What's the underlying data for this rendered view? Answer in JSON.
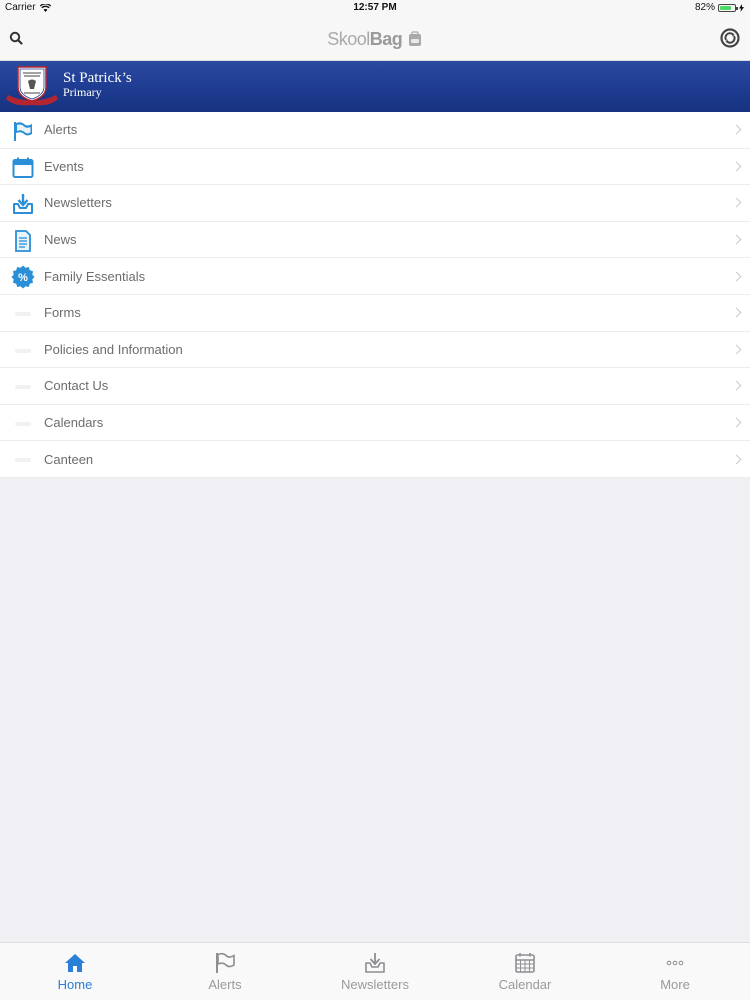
{
  "status_bar": {
    "carrier": "Carrier",
    "time": "12:57 PM",
    "battery": "82%",
    "battery_level": 0.82
  },
  "nav": {
    "logo_light": "Skool",
    "logo_bold": "Bag"
  },
  "banner": {
    "line1": "St Patrick’s",
    "line2": "Primary"
  },
  "menu": [
    {
      "label": "Alerts",
      "icon": "flag-icon"
    },
    {
      "label": "Events",
      "icon": "calendar-icon"
    },
    {
      "label": "Newsletters",
      "icon": "inbox-download-icon"
    },
    {
      "label": "News",
      "icon": "document-icon"
    },
    {
      "label": "Family Essentials",
      "icon": "percent-badge-icon"
    },
    {
      "label": "Forms",
      "icon": "placeholder-icon"
    },
    {
      "label": "Policies and Information",
      "icon": "placeholder-icon"
    },
    {
      "label": "Contact Us",
      "icon": "placeholder-icon"
    },
    {
      "label": "Calendars",
      "icon": "placeholder-icon"
    },
    {
      "label": "Canteen",
      "icon": "placeholder-icon"
    }
  ],
  "tabs": [
    {
      "label": "Home",
      "icon": "home-icon",
      "active": true
    },
    {
      "label": "Alerts",
      "icon": "flag-icon",
      "active": false
    },
    {
      "label": "Newsletters",
      "icon": "inbox-download-icon",
      "active": false
    },
    {
      "label": "Calendar",
      "icon": "calendar-icon",
      "active": false
    },
    {
      "label": "More",
      "icon": "more-dots-icon",
      "active": false
    }
  ],
  "colors": {
    "accent": "#2a7fd6",
    "banner": "#1c3a8f",
    "icon_blue": "#2a8fd6"
  }
}
